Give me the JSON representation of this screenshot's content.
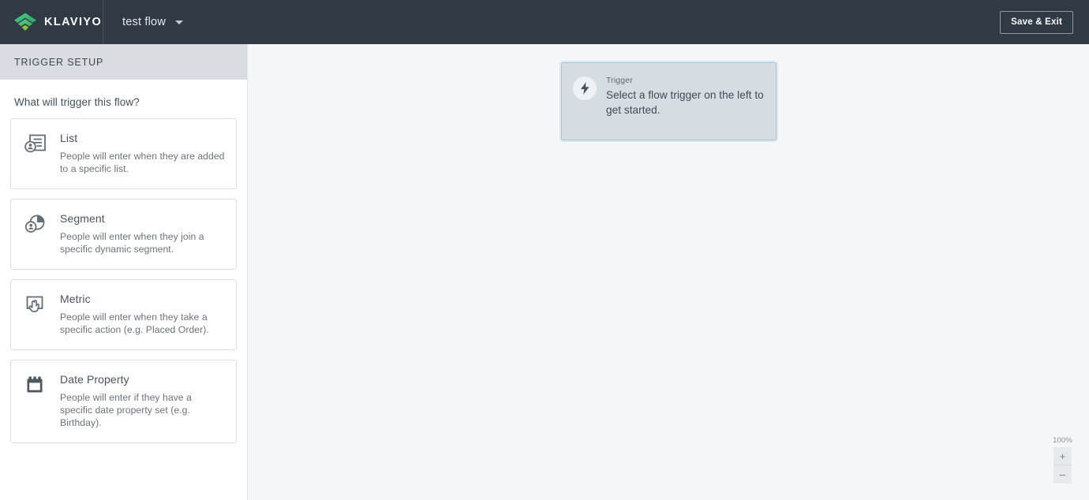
{
  "topbar": {
    "brand_name": "KLAVIYO",
    "brand_logo_icon": "klaviyo-logo-icon",
    "flow_name": "test flow",
    "flow_name_caret_icon": "chevron-down-icon",
    "save_exit_label": "Save & Exit",
    "background_color": "#2f3a45"
  },
  "sidebar": {
    "header_title": "TRIGGER SETUP",
    "header_background": "#d9dde1",
    "question": "What will trigger this flow?",
    "trigger_options": [
      {
        "icon": "list-document-person-icon",
        "title": "List",
        "description": "People will enter when they are added to a specific list."
      },
      {
        "icon": "segment-pie-person-icon",
        "title": "Segment",
        "description": "People will enter when they join a specific dynamic segment."
      },
      {
        "icon": "metric-click-hand-icon",
        "title": "Metric",
        "description": "People will enter when they take a specific action (e.g. Placed Order)."
      },
      {
        "icon": "date-property-calendar-icon",
        "title": "Date Property",
        "description": "People will enter if they have a specific date property set (e.g. Birthday)."
      }
    ]
  },
  "canvas": {
    "background_color": "#f4f6f8",
    "trigger_node": {
      "icon": "lightning-bolt-icon",
      "label": "Trigger",
      "description": "Select a flow trigger on the left to get started.",
      "background_color": "#d5dde3",
      "border_color": "#a9c8dd"
    },
    "zoom": {
      "level": "100%",
      "zoom_in_label": "+",
      "zoom_in_icon": "plus-icon",
      "zoom_out_label": "–",
      "zoom_out_icon": "minus-icon"
    }
  }
}
